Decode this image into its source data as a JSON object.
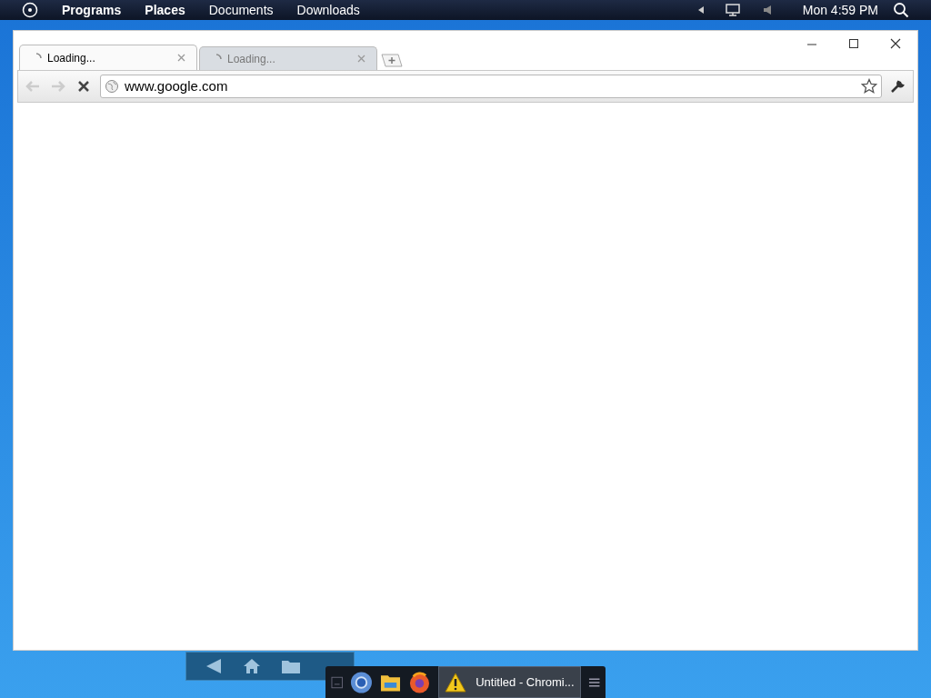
{
  "top_bar": {
    "menus": [
      "Programs",
      "Places",
      "Documents",
      "Downloads"
    ],
    "clock": "Mon 4:59 PM"
  },
  "browser": {
    "tabs": [
      {
        "label": "Loading...",
        "selected": true
      },
      {
        "label": "Loading...",
        "selected": false
      }
    ],
    "address": "www.google.com"
  },
  "taskbar": {
    "window_button": "Untitled - Chromi..."
  }
}
